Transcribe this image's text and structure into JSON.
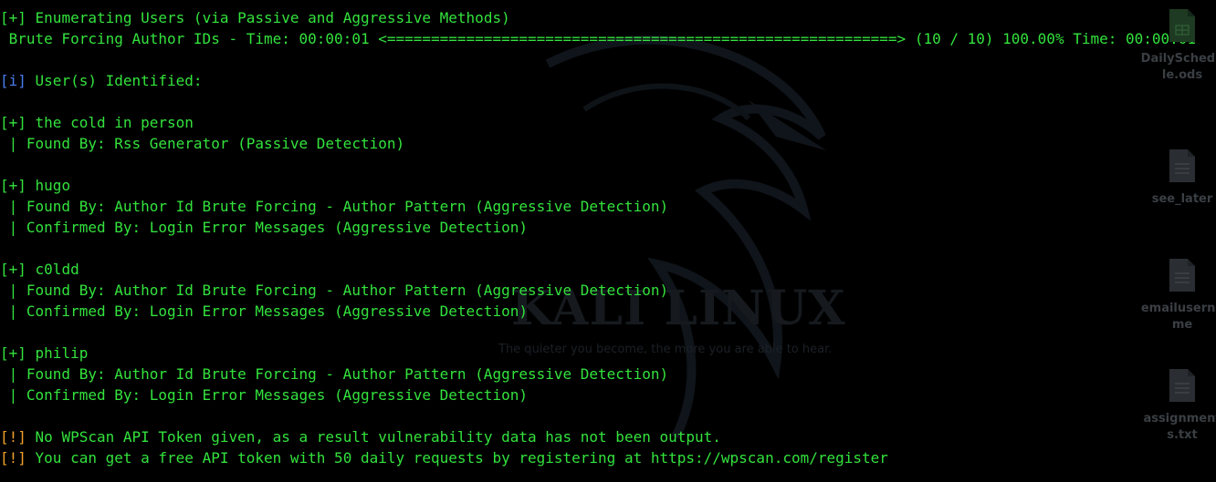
{
  "wallpaper": {
    "title": "KALI LINUX",
    "tagline": "The quieter you become, the more you are able to hear."
  },
  "terminal": {
    "lines": [
      {
        "indicator": "[+]",
        "type": "plus",
        "text": " Enumerating Users (via Passive and Aggressive Methods)"
      },
      {
        "indicator": "",
        "type": "plain",
        "text": " Brute Forcing Author IDs - Time: 00:00:01 <==========================================================> (10 / 10) 100.00% Time: 00:00:01"
      },
      {
        "indicator": "",
        "type": "plain",
        "text": ""
      },
      {
        "indicator": "[i]",
        "type": "info",
        "text": " User(s) Identified:"
      },
      {
        "indicator": "",
        "type": "plain",
        "text": ""
      },
      {
        "indicator": "[+]",
        "type": "plus",
        "text": " the cold in person"
      },
      {
        "indicator": "",
        "type": "plain",
        "text": " | Found By: Rss Generator (Passive Detection)"
      },
      {
        "indicator": "",
        "type": "plain",
        "text": ""
      },
      {
        "indicator": "[+]",
        "type": "plus",
        "text": " hugo"
      },
      {
        "indicator": "",
        "type": "plain",
        "text": " | Found By: Author Id Brute Forcing - Author Pattern (Aggressive Detection)"
      },
      {
        "indicator": "",
        "type": "plain",
        "text": " | Confirmed By: Login Error Messages (Aggressive Detection)"
      },
      {
        "indicator": "",
        "type": "plain",
        "text": ""
      },
      {
        "indicator": "[+]",
        "type": "plus",
        "text": " c0ldd"
      },
      {
        "indicator": "",
        "type": "plain",
        "text": " | Found By: Author Id Brute Forcing - Author Pattern (Aggressive Detection)"
      },
      {
        "indicator": "",
        "type": "plain",
        "text": " | Confirmed By: Login Error Messages (Aggressive Detection)"
      },
      {
        "indicator": "",
        "type": "plain",
        "text": ""
      },
      {
        "indicator": "[+]",
        "type": "plus",
        "text": " philip"
      },
      {
        "indicator": "",
        "type": "plain",
        "text": " | Found By: Author Id Brute Forcing - Author Pattern (Aggressive Detection)"
      },
      {
        "indicator": "",
        "type": "plain",
        "text": " | Confirmed By: Login Error Messages (Aggressive Detection)"
      },
      {
        "indicator": "",
        "type": "plain",
        "text": ""
      },
      {
        "indicator": "[!]",
        "type": "warn",
        "text": " No WPScan API Token given, as a result vulnerability data has not been output."
      },
      {
        "indicator": "[!]",
        "type": "warn",
        "text": " You can get a free API token with 50 daily requests by registering at https://wpscan.com/register"
      }
    ]
  },
  "desktop": {
    "icons": [
      {
        "label_line1": "DailySchedu",
        "label_line2": "le.ods",
        "icon": "spreadsheet-icon"
      },
      {
        "label_line1": "see_later",
        "label_line2": "",
        "icon": "text-file-icon"
      },
      {
        "label_line1": "emailuserna",
        "label_line2": "me",
        "icon": "text-file-icon"
      },
      {
        "label_line1": "assignment",
        "label_line2": "s.txt",
        "icon": "text-file-icon"
      }
    ]
  },
  "colors": {
    "terminal_text": "#33e23d",
    "info": "#4a7cf0",
    "warn": "#f0a02a",
    "background": "#000000"
  }
}
